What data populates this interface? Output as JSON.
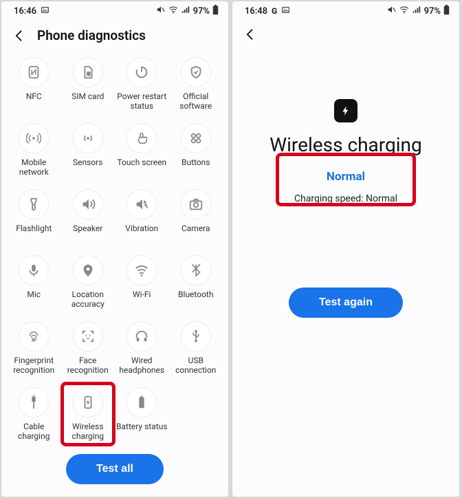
{
  "left": {
    "status": {
      "time": "16:46",
      "battery": "97%"
    },
    "header": {
      "title": "Phone diagnostics"
    },
    "items": [
      {
        "label": "NFC",
        "icon": "nfc"
      },
      {
        "label": "SIM card",
        "icon": "sim"
      },
      {
        "label": "Power restart\nstatus",
        "icon": "power"
      },
      {
        "label": "Official\nsoftware",
        "icon": "shield"
      },
      {
        "label": "Mobile\nnetwork",
        "icon": "antenna"
      },
      {
        "label": "Sensors",
        "icon": "sensors"
      },
      {
        "label": "Touch screen",
        "icon": "touch"
      },
      {
        "label": "Buttons",
        "icon": "buttons"
      },
      {
        "label": "Flashlight",
        "icon": "flashlight"
      },
      {
        "label": "Speaker",
        "icon": "speaker"
      },
      {
        "label": "Vibration",
        "icon": "vibration"
      },
      {
        "label": "Camera",
        "icon": "camera"
      },
      {
        "label": "Mic",
        "icon": "mic"
      },
      {
        "label": "Location\naccuracy",
        "icon": "location"
      },
      {
        "label": "Wi-Fi",
        "icon": "wifi"
      },
      {
        "label": "Bluetooth",
        "icon": "bluetooth"
      },
      {
        "label": "Fingerprint\nrecognition",
        "icon": "fingerprint"
      },
      {
        "label": "Face\nrecognition",
        "icon": "face"
      },
      {
        "label": "Wired\nheadphones",
        "icon": "headphones"
      },
      {
        "label": "USB\nconnection",
        "icon": "usb"
      },
      {
        "label": "Cable\ncharging",
        "icon": "cable"
      },
      {
        "label": "Wireless\ncharging",
        "icon": "bolt"
      },
      {
        "label": "Battery status",
        "icon": "battery"
      }
    ],
    "footer": {
      "test_all": "Test all"
    },
    "highlighted_index": 21
  },
  "right": {
    "status": {
      "time": "16:48",
      "apps": "G",
      "battery": "97%"
    },
    "result": {
      "title": "Wireless charging",
      "status": "Normal",
      "detail": "Charging speed: Normal",
      "button": "Test again"
    }
  }
}
